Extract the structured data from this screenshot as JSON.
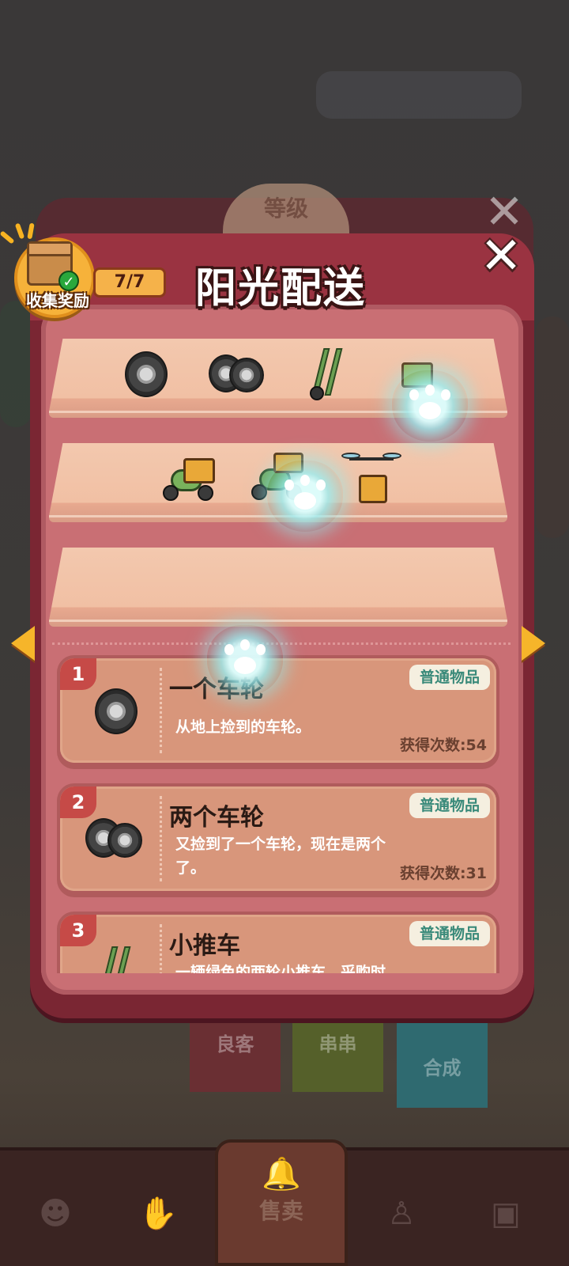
{
  "header": {
    "title": "阳光配送",
    "close_symbol": "✕",
    "collect_reward_label": "收集奖励",
    "collection_progress": "7/7"
  },
  "background": {
    "level_badge": "等级",
    "tabs": [
      "良客",
      "串串",
      "合成"
    ],
    "nav_sell_label": "售卖"
  },
  "shelves": [
    {
      "items": [
        "tire-icon",
        "double-tire-icon",
        "hand-truck-icon",
        "cart-with-box-icon"
      ]
    },
    {
      "items": [
        "scooter-parcel-icon",
        "delivery-scooter-icon",
        "drone-parcel-icon"
      ]
    },
    {
      "items": []
    }
  ],
  "items": [
    {
      "index": "1",
      "name": "一个车轮",
      "description": "从地上捡到的车轮。",
      "tag": "普通物品",
      "count_label": "获得次数:54"
    },
    {
      "index": "2",
      "name": "两个车轮",
      "description": "又捡到了一个车轮，现在是两个了。",
      "tag": "普通物品",
      "count_label": "获得次数:31"
    },
    {
      "index": "3",
      "name": "小推车",
      "description": "一辆绿色的两轮小推车，采购时",
      "tag": "普通物品",
      "count_label": ""
    }
  ],
  "colors": {
    "panel": "#7a2633",
    "panel_inner": "#c96f74",
    "shelf": "#f3c8ae",
    "card": "#d8967b",
    "tag_text": "#3a8a7a",
    "badge": "#f6b23a"
  }
}
